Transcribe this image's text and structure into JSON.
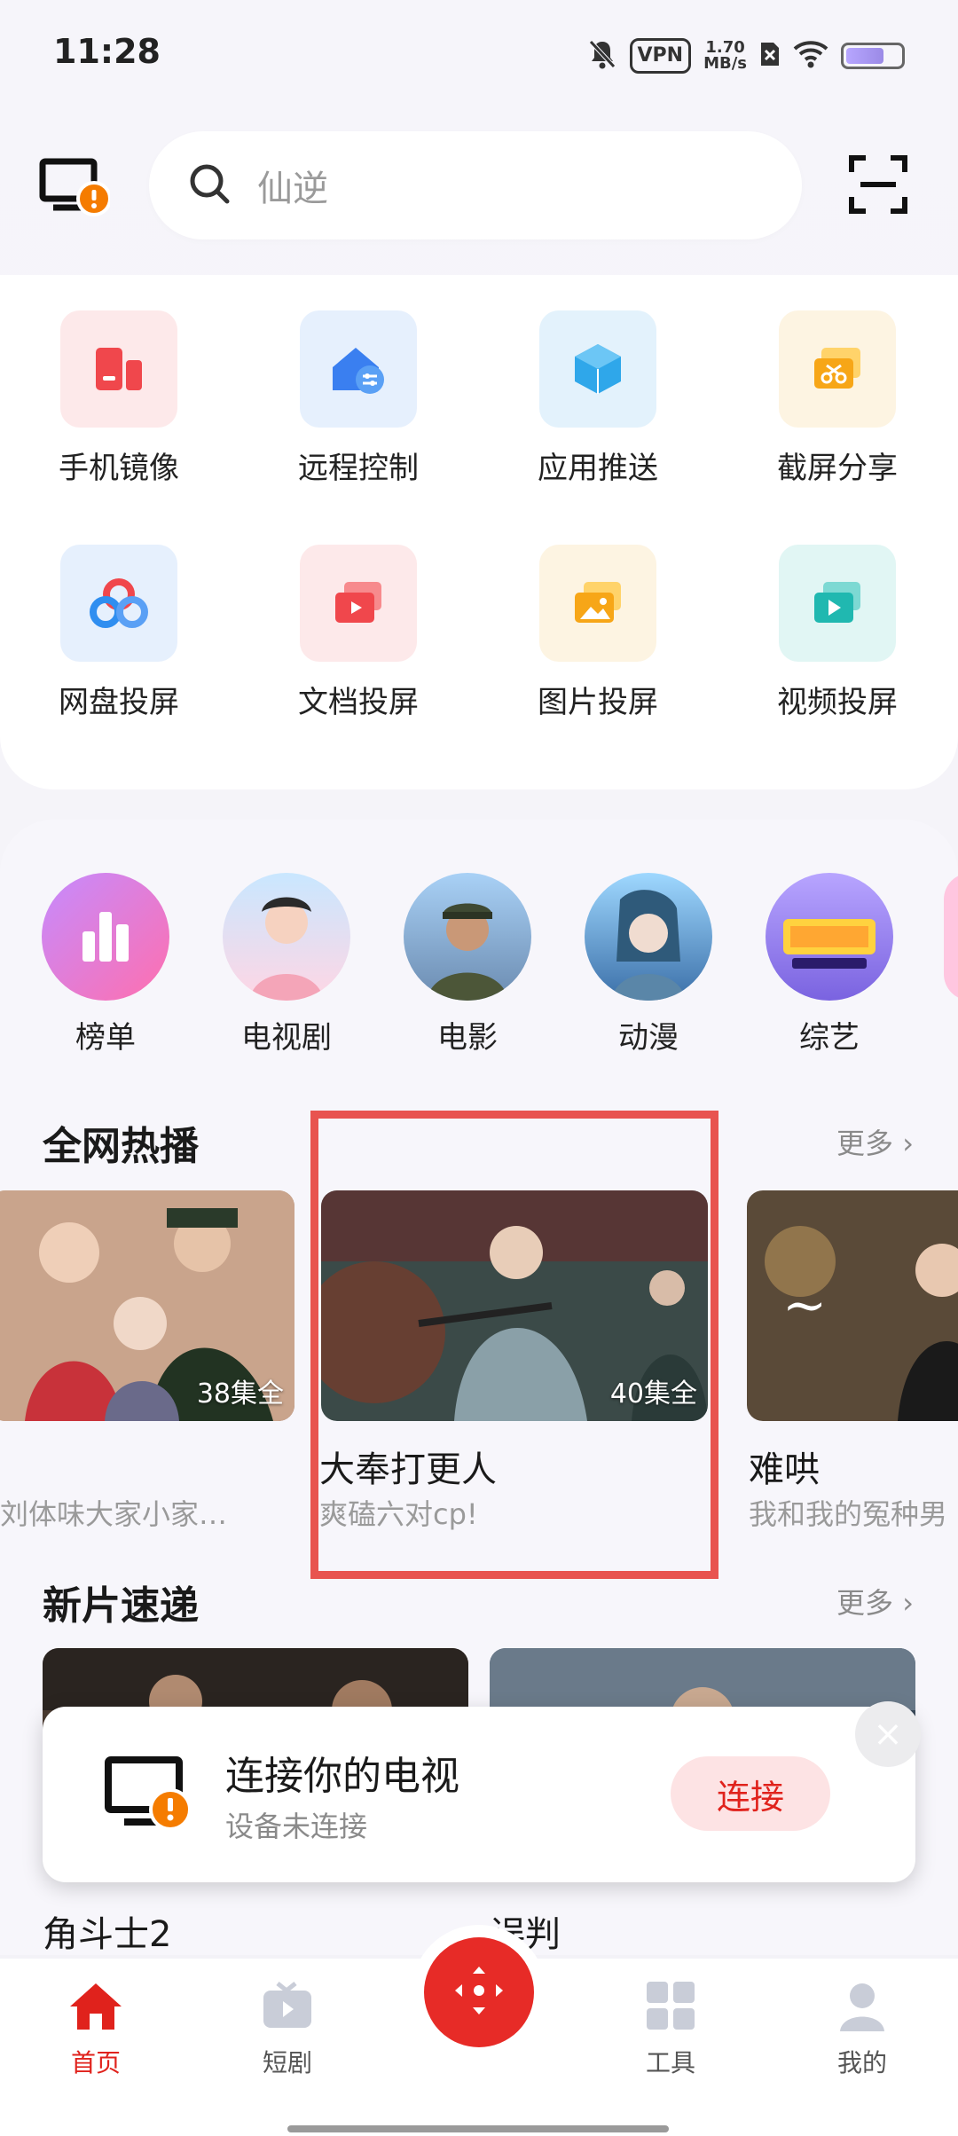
{
  "status_bar": {
    "time": "11:28",
    "vpn": "VPN",
    "speed_value": "1.70",
    "speed_unit": "MB/s",
    "icons": [
      "mute-icon",
      "vpn-icon",
      "speed-icon",
      "no-sim-icon",
      "wifi-icon",
      "battery-icon"
    ]
  },
  "header": {
    "search_placeholder": "仙逆",
    "icons": [
      "monitor-alert-icon",
      "search-icon",
      "scan-icon"
    ]
  },
  "tools": [
    {
      "label": "手机镜像",
      "icon": "phone-mirror-icon",
      "color": "#f0474c"
    },
    {
      "label": "远程控制",
      "icon": "remote-control-icon",
      "color": "#3a7ff0"
    },
    {
      "label": "应用推送",
      "icon": "app-push-icon",
      "color": "#2fa7ea"
    },
    {
      "label": "截屏分享",
      "icon": "screenshot-share-icon",
      "color": "#f7a617"
    },
    {
      "label": "网盘投屏",
      "icon": "cloud-cast-icon",
      "color": "#2f8ef0"
    },
    {
      "label": "文档投屏",
      "icon": "document-cast-icon",
      "color": "#f0474c"
    },
    {
      "label": "图片投屏",
      "icon": "image-cast-icon",
      "color": "#f7a617"
    },
    {
      "label": "视频投屏",
      "icon": "video-cast-icon",
      "color": "#20b8b0"
    }
  ],
  "categories": [
    {
      "label": "榜单"
    },
    {
      "label": "电视剧"
    },
    {
      "label": "电影"
    },
    {
      "label": "动漫"
    },
    {
      "label": "综艺"
    }
  ],
  "hot": {
    "title": "全网热播",
    "more": "更多",
    "items": [
      {
        "badge": "38集全",
        "sub": "刘体味大家小家…"
      },
      {
        "badge": "40集全",
        "title": "大奉打更人",
        "sub": "爽磕六对cp!"
      },
      {
        "title": "难哄",
        "sub": "我和我的冤种男"
      }
    ]
  },
  "new": {
    "title": "新片速递",
    "more": "更多",
    "items": [
      {
        "title": "角斗士2"
      },
      {
        "title": "误判"
      }
    ]
  },
  "toast": {
    "title": "连接你的电视",
    "subtitle": "设备未连接",
    "button": "连接",
    "close": "×"
  },
  "nav": {
    "home": "首页",
    "short": "短剧",
    "tools": "工具",
    "mine": "我的"
  },
  "colors": {
    "accent": "#e0221c",
    "highlight": "#e8544f"
  }
}
